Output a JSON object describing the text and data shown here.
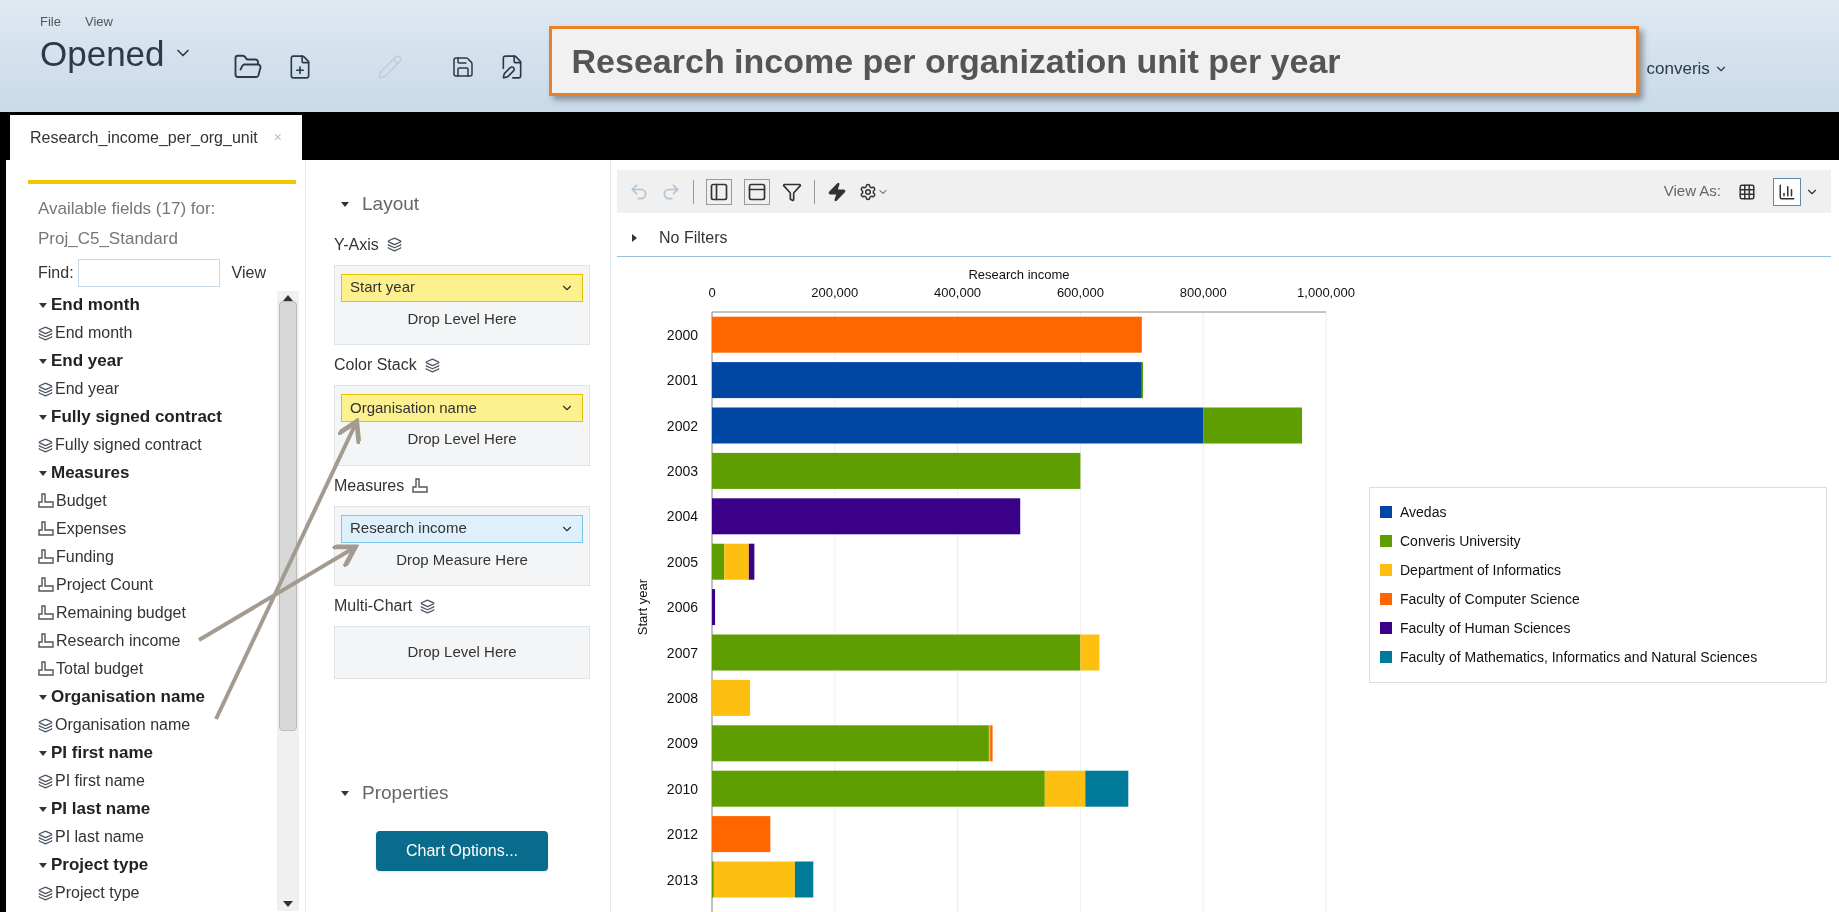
{
  "menu": [
    "File",
    "View"
  ],
  "header": {
    "title": "Opened",
    "user": "converis"
  },
  "overlay_title": "Research income per organization unit per year",
  "tabs": [
    {
      "label": "Research_income_per_org_unit",
      "close": "×",
      "selected": true
    }
  ],
  "fields_panel": {
    "heading": "Available fields (17) for:",
    "source": "Proj_C5_Standard",
    "find_label": "Find:",
    "view_link": "View",
    "groups": [
      {
        "label": "End month",
        "expanded": true,
        "children": [
          {
            "label": "End month",
            "kind": "level"
          }
        ]
      },
      {
        "label": "End year",
        "expanded": true,
        "children": [
          {
            "label": "End year",
            "kind": "level"
          }
        ]
      },
      {
        "label": "Fully signed contract",
        "expanded": true,
        "children": [
          {
            "label": "Fully signed contract",
            "kind": "level"
          }
        ]
      },
      {
        "label": "Measures",
        "expanded": true,
        "children": [
          {
            "label": "Budget",
            "kind": "measure"
          },
          {
            "label": "Expenses",
            "kind": "measure"
          },
          {
            "label": "Funding",
            "kind": "measure"
          },
          {
            "label": "Project Count",
            "kind": "measure"
          },
          {
            "label": "Remaining budget",
            "kind": "measure"
          },
          {
            "label": "Research income",
            "kind": "measure"
          },
          {
            "label": "Total budget",
            "kind": "measure"
          }
        ]
      },
      {
        "label": "Organisation name",
        "expanded": true,
        "children": [
          {
            "label": "Organisation name",
            "kind": "level"
          }
        ]
      },
      {
        "label": "PI first name",
        "expanded": true,
        "children": [
          {
            "label": "PI first name",
            "kind": "level"
          }
        ]
      },
      {
        "label": "PI last name",
        "expanded": true,
        "children": [
          {
            "label": "PI last name",
            "kind": "level"
          }
        ]
      },
      {
        "label": "Project type",
        "expanded": true,
        "children": [
          {
            "label": "Project type",
            "kind": "level"
          }
        ]
      }
    ]
  },
  "layout_panel": {
    "title": "Layout",
    "expanded": true,
    "zones": [
      {
        "label": "Y-Axis",
        "kind": "level",
        "items": [
          {
            "label": "Start year"
          }
        ],
        "drop": "Drop Level Here"
      },
      {
        "label": "Color Stack",
        "kind": "level",
        "items": [
          {
            "label": "Organisation name"
          }
        ],
        "drop": "Drop Level Here"
      },
      {
        "label": "Measures",
        "kind": "measure",
        "items": [
          {
            "label": "Research income"
          }
        ],
        "drop": "Drop Measure Here"
      },
      {
        "label": "Multi-Chart",
        "kind": "level",
        "drop": "Drop Level Here"
      }
    ],
    "properties": {
      "title": "Properties",
      "expanded": true,
      "button": "Chart Options..."
    }
  },
  "toolbar": {
    "view_as": "View As:",
    "views": [
      {
        "kind": "table",
        "selected": false
      },
      {
        "kind": "chart",
        "selected": true
      }
    ]
  },
  "filters": {
    "label": "No Filters",
    "expanded": false
  },
  "chart": {
    "chart_data": {
      "type": "bar",
      "orientation": "horizontal",
      "stacked": true,
      "grid": true,
      "legend": true,
      "xlabel": "Research income",
      "ylabel": "Start year",
      "categories": [
        "2000",
        "2001",
        "2002",
        "2003",
        "2004",
        "2005",
        "2006",
        "2007",
        "2008",
        "2009",
        "2010",
        "2012",
        "2013"
      ],
      "xlim": [
        0,
        1000000
      ],
      "xticks": [
        {
          "value": 0,
          "label": "0"
        },
        {
          "value": 200000,
          "label": "200,000"
        },
        {
          "value": 400000,
          "label": "400,000"
        },
        {
          "value": 600000,
          "label": "600,000"
        },
        {
          "value": 800000,
          "label": "800,000"
        },
        {
          "value": 1000000,
          "label": "1,000,000"
        }
      ],
      "series": [
        {
          "name": "Avedas",
          "color": "#0047a3",
          "values": [
            null,
            700000,
            800000,
            null,
            null,
            null,
            null,
            null,
            null,
            null,
            null,
            null,
            null
          ]
        },
        {
          "name": "Converis University",
          "color": "#5f9e00",
          "values": [
            null,
            2000,
            161000,
            600000,
            null,
            20000,
            null,
            600000,
            null,
            451000,
            542000,
            null,
            3000
          ]
        },
        {
          "name": "Department of Informatics",
          "color": "#fdc010",
          "values": [
            null,
            null,
            null,
            null,
            null,
            40000,
            null,
            31000,
            62000,
            2000,
            66000,
            null,
            132000
          ]
        },
        {
          "name": "Faculty of Computer Science",
          "color": "#ff6600",
          "values": [
            700000,
            null,
            null,
            null,
            null,
            null,
            null,
            null,
            null,
            4000,
            null,
            95000,
            null
          ]
        },
        {
          "name": "Faculty of Human Sciences",
          "color": "#3b0088",
          "values": [
            null,
            null,
            null,
            null,
            502000,
            9000,
            5000,
            null,
            null,
            null,
            null,
            null,
            null
          ]
        },
        {
          "name": "Faculty of Mathematics, Informatics and Natural Sciences",
          "color": "#007a99",
          "values": [
            null,
            null,
            null,
            null,
            null,
            null,
            null,
            null,
            null,
            null,
            70000,
            null,
            30000
          ]
        }
      ]
    }
  }
}
